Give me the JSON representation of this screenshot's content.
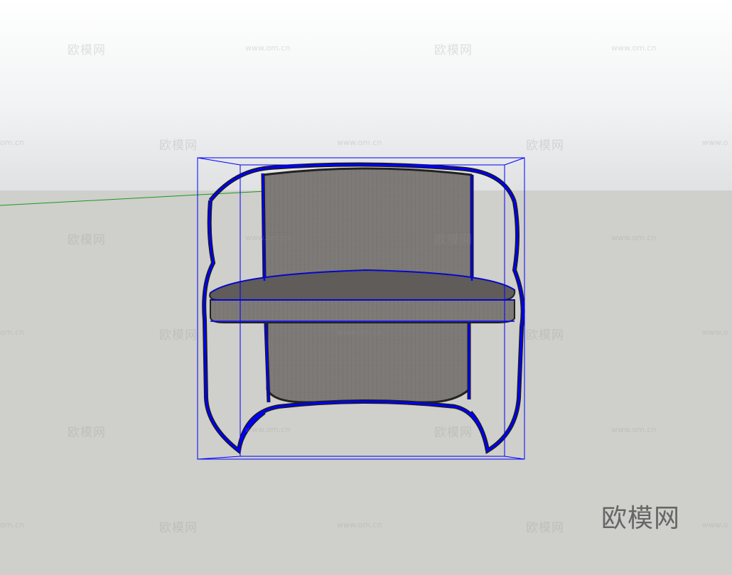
{
  "watermarks": {
    "text": "欧模网",
    "url": "www.om.cn",
    "url_partial": "om.cn",
    "url_prefix": "www.o"
  },
  "logo": {
    "text": "欧模网"
  },
  "colors": {
    "selection": "#0000ff",
    "axis_green": "#1a9a1a",
    "fabric": "#7b7876",
    "fabric_dark": "#5f5c5a",
    "frame": "#1a1a1a"
  }
}
